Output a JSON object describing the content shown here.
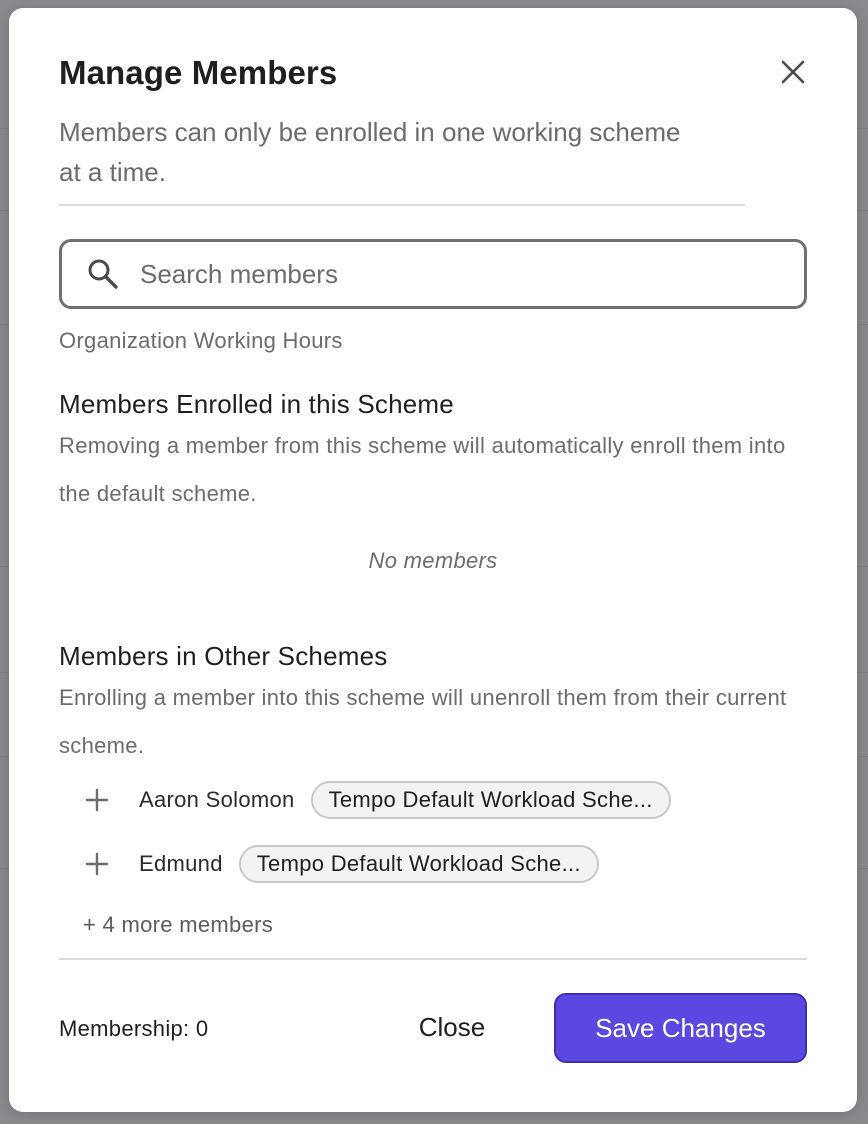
{
  "modal": {
    "title": "Manage Members",
    "subtitle": "Members can only be enrolled in one working scheme at a time.",
    "close_icon": "close-icon"
  },
  "search": {
    "placeholder": "Search members",
    "value": "",
    "icon": "search-icon"
  },
  "scheme_name": "Organization Working Hours",
  "enrolled": {
    "title": "Members Enrolled in this Scheme",
    "description": "Removing a member from this scheme will automatically enroll them into the default scheme.",
    "empty_text": "No members"
  },
  "other": {
    "title": "Members in Other Schemes",
    "description": "Enrolling a member into this scheme will unenroll them from their current scheme.",
    "members": [
      {
        "name": "Aaron Solomon",
        "scheme": "Tempo Default Workload Sche..."
      },
      {
        "name": "Edmund",
        "scheme": "Tempo Default Workload Sche..."
      }
    ],
    "more_label": "+ 4 more members"
  },
  "footer": {
    "membership_label": "Membership: 0",
    "close_label": "Close",
    "save_label": "Save Changes"
  },
  "colors": {
    "primary": "#5a48e0",
    "primary_border": "#3b2fb0",
    "text": "#1f1f22",
    "muted": "#6b6b70"
  }
}
